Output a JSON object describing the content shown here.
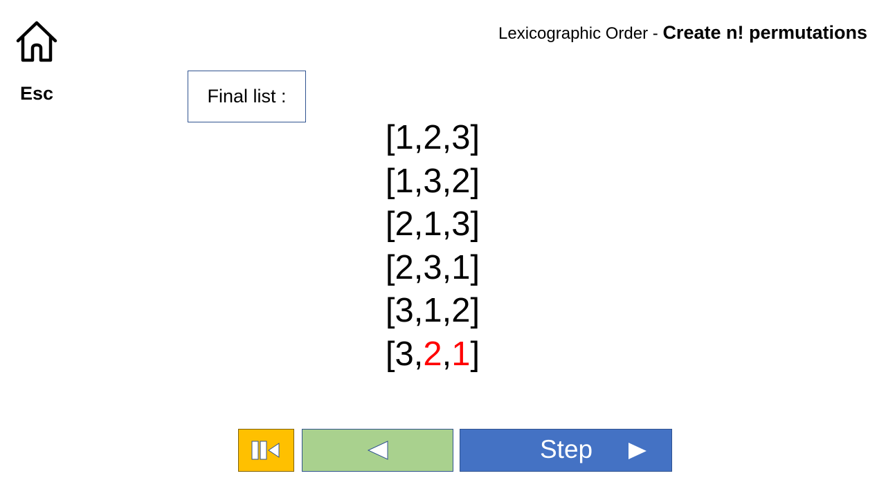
{
  "header": {
    "title_prefix": "Lexicographic Order - ",
    "title_bold": "Create n! permutations"
  },
  "home": {
    "icon": "home-icon",
    "label": "Esc"
  },
  "final_list_label": "Final list :",
  "permutations": [
    {
      "parts": [
        "[1,",
        "2",
        ",",
        "3",
        "]"
      ]
    },
    {
      "parts": [
        "[1,",
        "3",
        ",",
        "2",
        "]"
      ]
    },
    {
      "parts": [
        "[2,",
        "1",
        ",",
        "3",
        "]"
      ]
    },
    {
      "parts": [
        "[2,",
        "3",
        ",",
        "1",
        "]"
      ]
    },
    {
      "parts": [
        "[3,",
        "1",
        ",",
        "2",
        "]"
      ]
    },
    {
      "parts": [
        "[3,",
        "2",
        ",",
        "1",
        "]"
      ],
      "highlighted": [
        1,
        3
      ]
    }
  ],
  "controls": {
    "reset_icon": "reset-icon",
    "back_icon": "triangle-left-icon",
    "step_label": "Step",
    "step_icon": "triangle-right-icon"
  },
  "colors": {
    "highlight": "#ff0000",
    "reset_button": "#ffc000",
    "back_button": "#a9d18e",
    "step_button": "#4472c4"
  }
}
